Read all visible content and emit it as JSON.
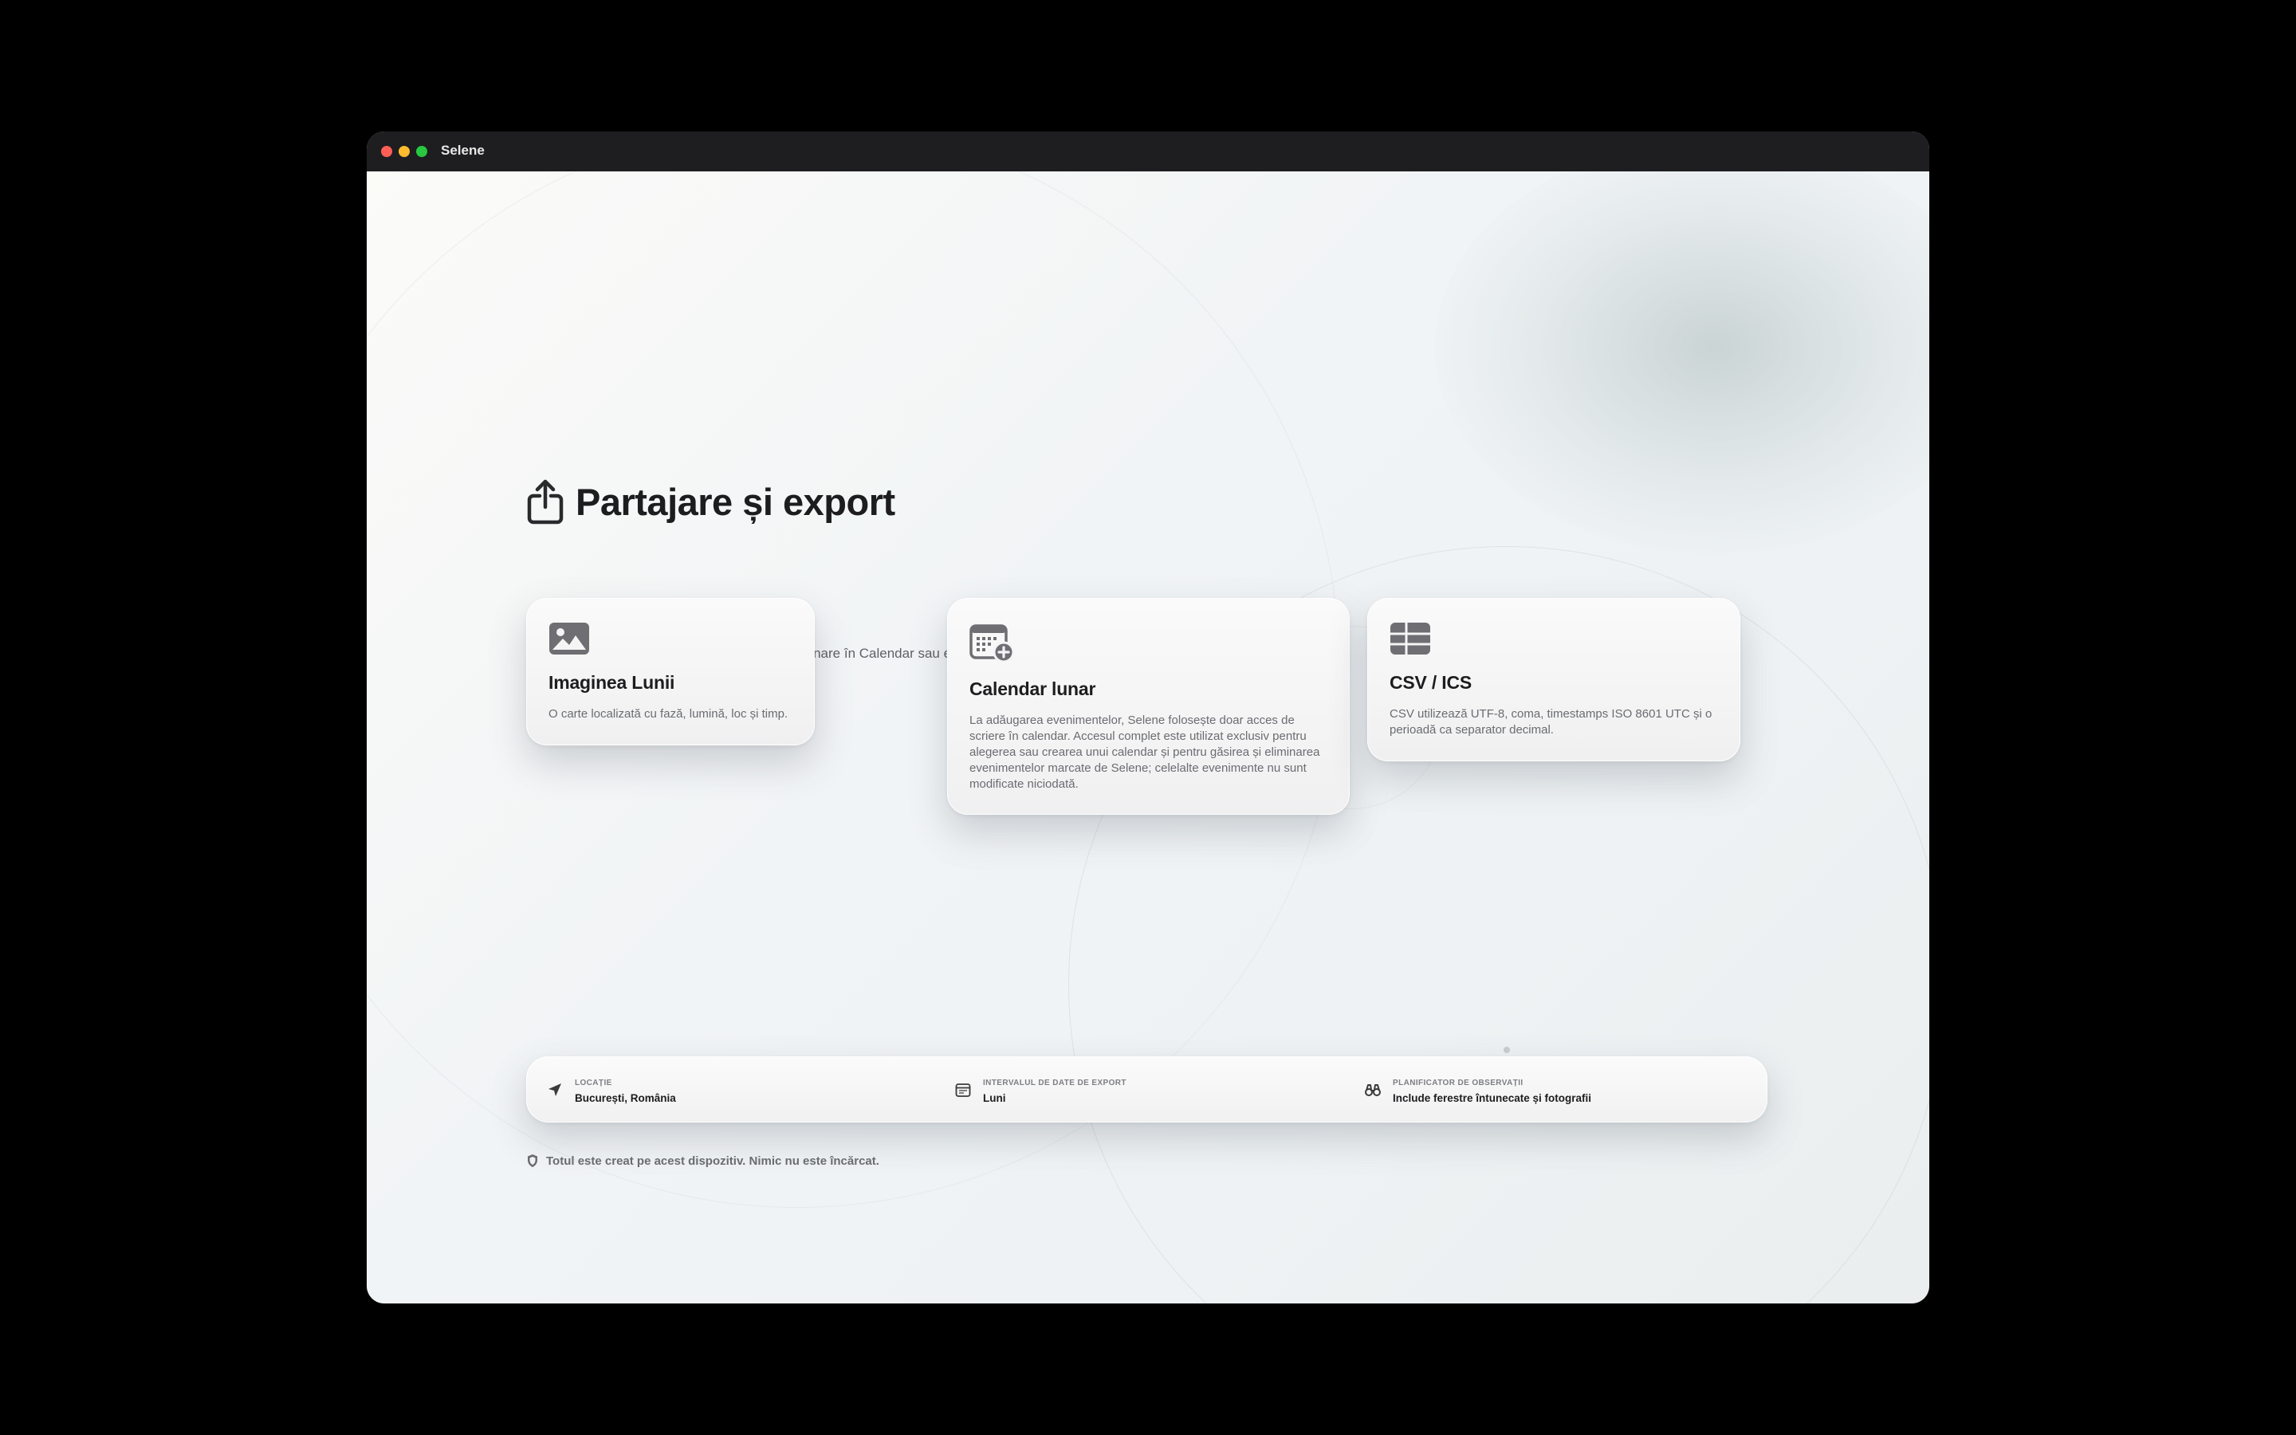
{
  "window": {
    "title": "Selene"
  },
  "header": {
    "icon": "share-icon",
    "title": "Partajare și export",
    "subtitle": "Partajează Luna actuală, adaugă evenimente lunare în Calendar sau exportă date de efemeride."
  },
  "cards": [
    {
      "icon": "photo-icon",
      "title": "Imaginea Lunii",
      "description": "O carte localizată cu fază, lumină, loc și timp."
    },
    {
      "icon": "calendar-add-icon",
      "title": "Calendar lunar",
      "description": "La adăugarea evenimentelor, Selene folosește doar acces de scriere în calendar. Accesul complet este utilizat exclusiv pentru alegerea sau crearea unui calendar și pentru găsirea și eliminarea evenimentelor marcate de Selene; celelalte evenimente nu sunt modificate niciodată."
    },
    {
      "icon": "table-icon",
      "title": "CSV / ICS",
      "description": "CSV utilizează UTF-8, coma, timestamps ISO 8601 UTC și o perioadă ca separator decimal."
    }
  ],
  "info": [
    {
      "icon": "location-arrow-icon",
      "label": "LOCAȚIE",
      "value": "București, România"
    },
    {
      "icon": "calendar-icon",
      "label": "INTERVALUL DE DATE DE EXPORT",
      "value": "Luni"
    },
    {
      "icon": "binoculars-icon",
      "label": "PLANIFICATOR DE OBSERVAȚII",
      "value": "Include ferestre întunecate și fotografii"
    }
  ],
  "footer": {
    "icon": "shield-icon",
    "text": "Totul este creat pe acest dispozitiv. Nimic nu este încărcat."
  },
  "colors": {
    "icon_gray": "#6e6e73",
    "title_text": "#1d1d1f",
    "secondary_text": "#6a6c70",
    "titlebar": "#1e1e20"
  }
}
